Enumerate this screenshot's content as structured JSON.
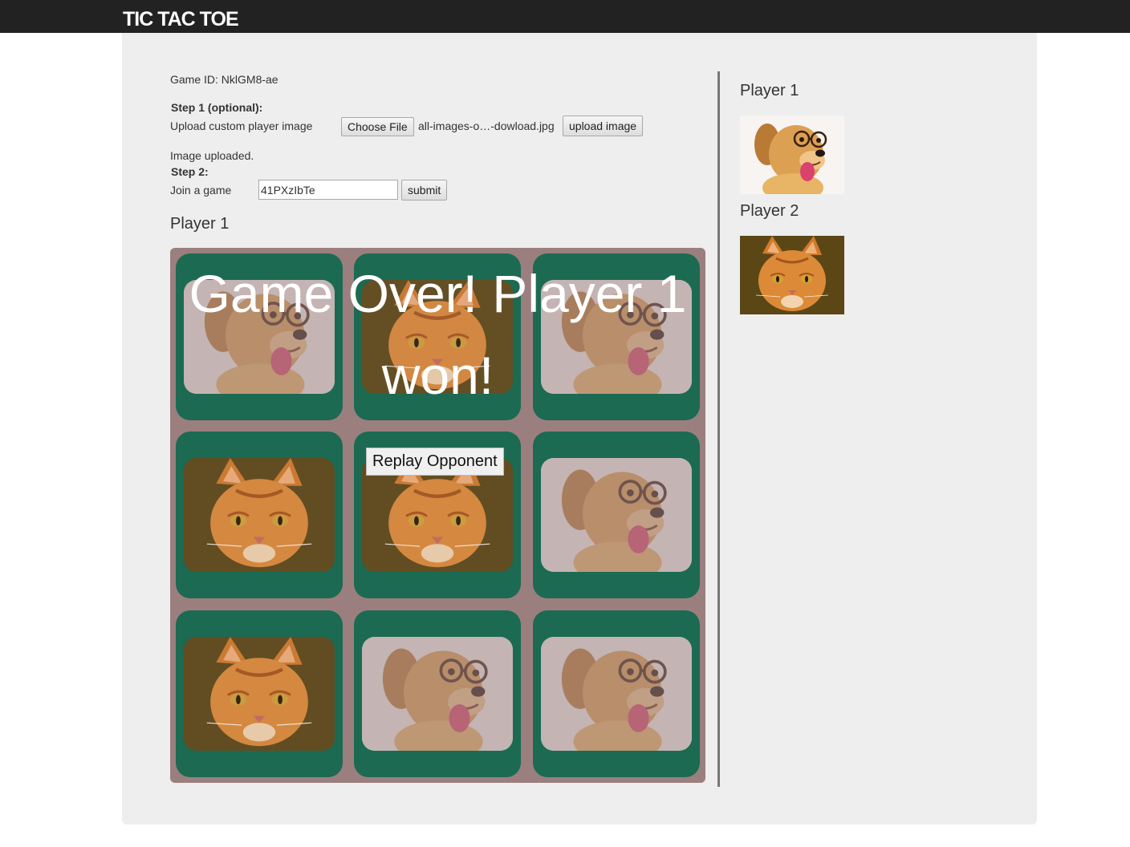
{
  "header": {
    "brand": "TIC TAC TOE"
  },
  "game": {
    "id_text": "Game ID: NklGM8-ae"
  },
  "step1": {
    "title": "Step 1 (optional):",
    "label": "Upload custom player image",
    "choose_file_label": "Choose File",
    "file_name": "all-images-o…-dowload.jpg",
    "upload_label": "upload image"
  },
  "status": {
    "upload_message": "Image uploaded."
  },
  "step2": {
    "title": "Step 2:",
    "label": "Join a game",
    "game_code_value": "41PXzIbTe",
    "submit_label": "submit"
  },
  "board": {
    "current_player": "Player 1",
    "cells": [
      "dog",
      "cat",
      "dog",
      "cat",
      "cat",
      "dog",
      "cat",
      "dog",
      "dog"
    ],
    "overlay_message": "Game Over! Player 1 won!",
    "replay_label": "Replay Opponent"
  },
  "players": [
    {
      "label": "Player 1",
      "image": "dog-with-glasses"
    },
    {
      "label": "Player 2",
      "image": "orange-cat"
    }
  ],
  "colors": {
    "topbar": "#222222",
    "panel": "#eeeeee",
    "board_bg": "#9b7f7f",
    "cell_bg": "#1c6a52"
  }
}
